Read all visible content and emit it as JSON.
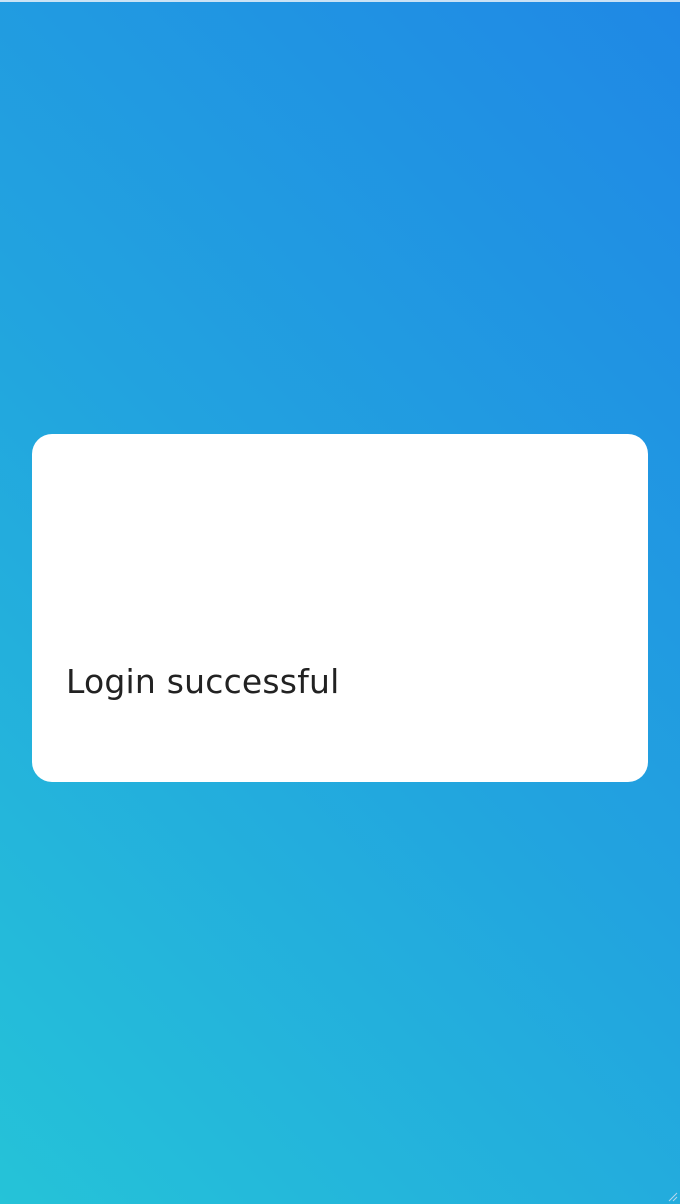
{
  "status": {
    "message": "Login successful"
  },
  "theme": {
    "gradient_start": "#25c3d8",
    "gradient_end": "#1f88e5",
    "card_background": "#ffffff",
    "text_color": "#222222"
  },
  "icons": {
    "corner": "resize-grip-icon"
  }
}
